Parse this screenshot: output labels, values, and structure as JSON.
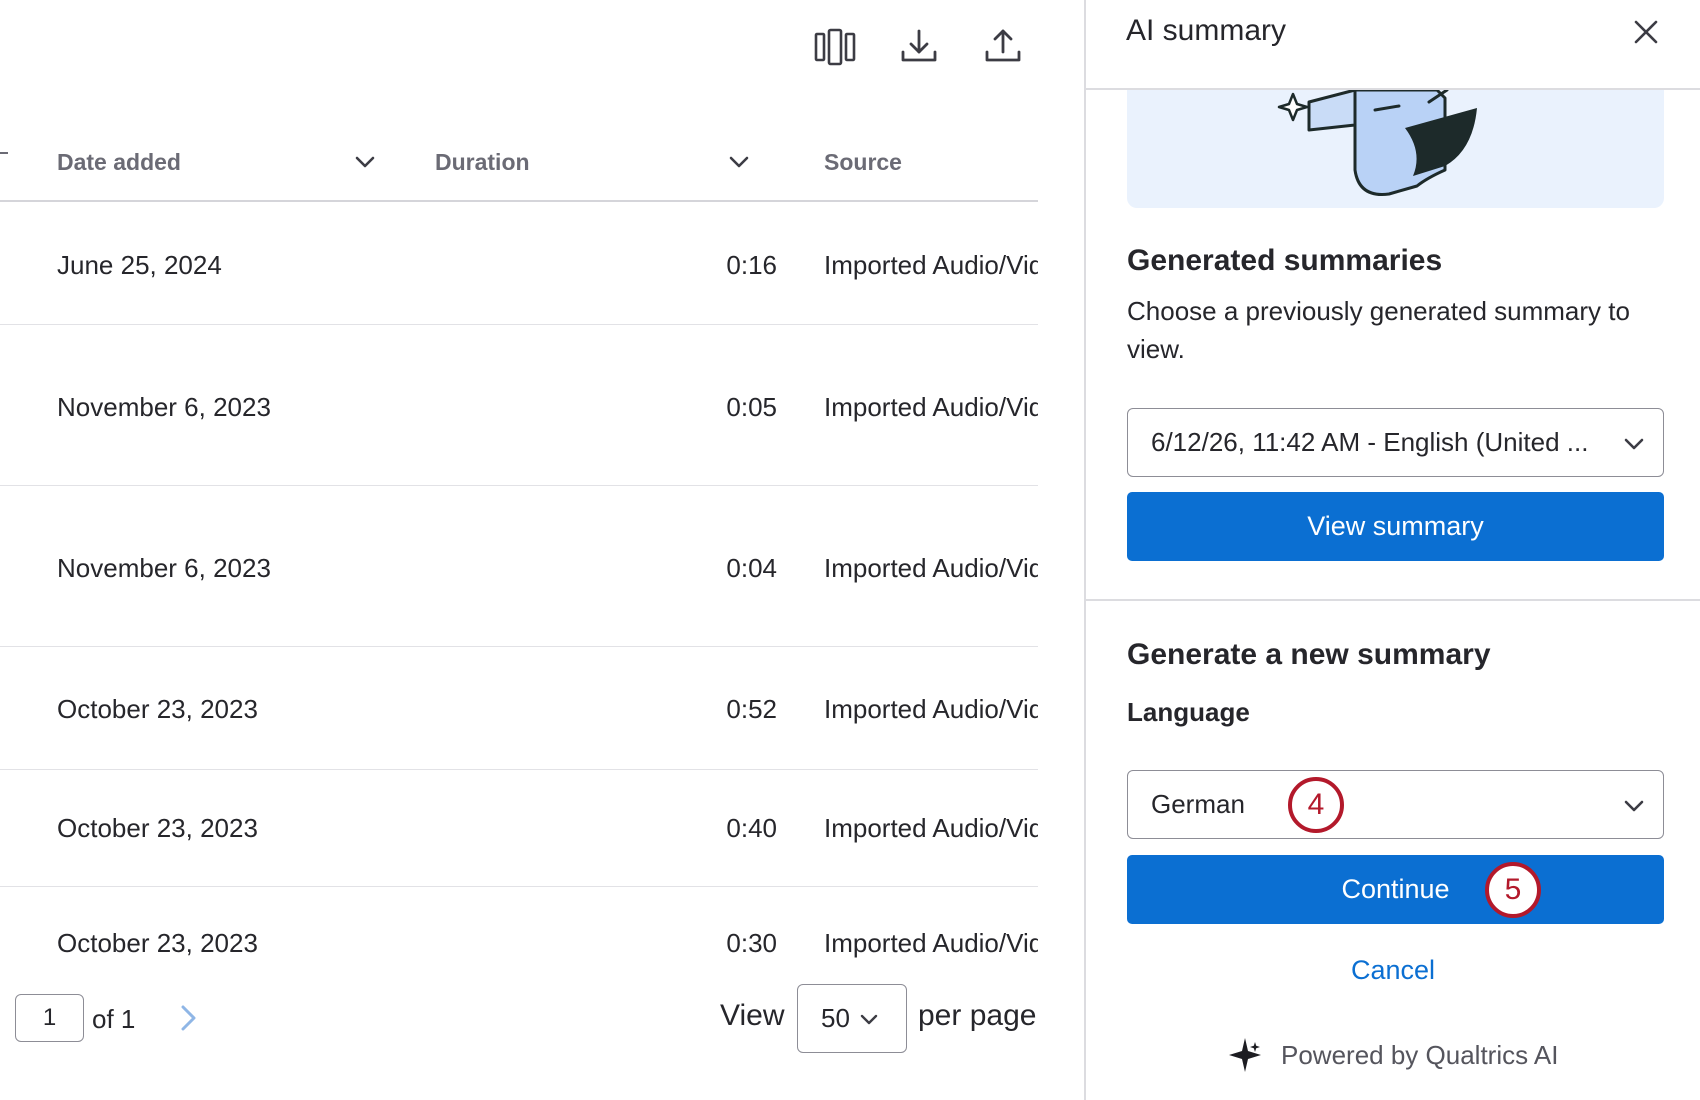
{
  "toolbar": {
    "icons": [
      "columns-icon",
      "download-icon",
      "upload-icon"
    ]
  },
  "table": {
    "columns": [
      {
        "label": "Date added"
      },
      {
        "label": "Duration"
      },
      {
        "label": "Source"
      }
    ],
    "rows": [
      {
        "date": "June 25, 2024",
        "duration": "0:16",
        "source": "Imported Audio/Video"
      },
      {
        "date": "November 6, 2023",
        "duration": "0:05",
        "source": "Imported Audio/Video"
      },
      {
        "date": "November 6, 2023",
        "duration": "0:04",
        "source": "Imported Audio/Video"
      },
      {
        "date": "October 23, 2023",
        "duration": "0:52",
        "source": "Imported Audio/Video"
      },
      {
        "date": "October 23, 2023",
        "duration": "0:40",
        "source": "Imported Audio/Video"
      },
      {
        "date": "October 23, 2023",
        "duration": "0:30",
        "source": "Imported Audio/Video"
      }
    ]
  },
  "pagination": {
    "current_page": "1",
    "of_label": "of 1",
    "view_label": "View",
    "per_page_value": "50",
    "per_page_label": "per page"
  },
  "panel": {
    "title": "AI summary",
    "generated": {
      "heading": "Generated summaries",
      "description": "Choose a previously generated summary to view.",
      "selected_summary": "6/12/26, 11:42 AM - English (United ...",
      "view_button": "View summary"
    },
    "new_summary": {
      "heading": "Generate a new summary",
      "language_label": "Language",
      "language_value": "German",
      "continue_button": "Continue",
      "cancel_link": "Cancel"
    },
    "powered_by": "Powered by Qualtrics AI"
  },
  "step_markers": [
    "4",
    "5"
  ],
  "colors": {
    "primary": "#0b6fd2",
    "step_marker": "#b3192b",
    "illustration_bg": "#eaf2fd"
  }
}
